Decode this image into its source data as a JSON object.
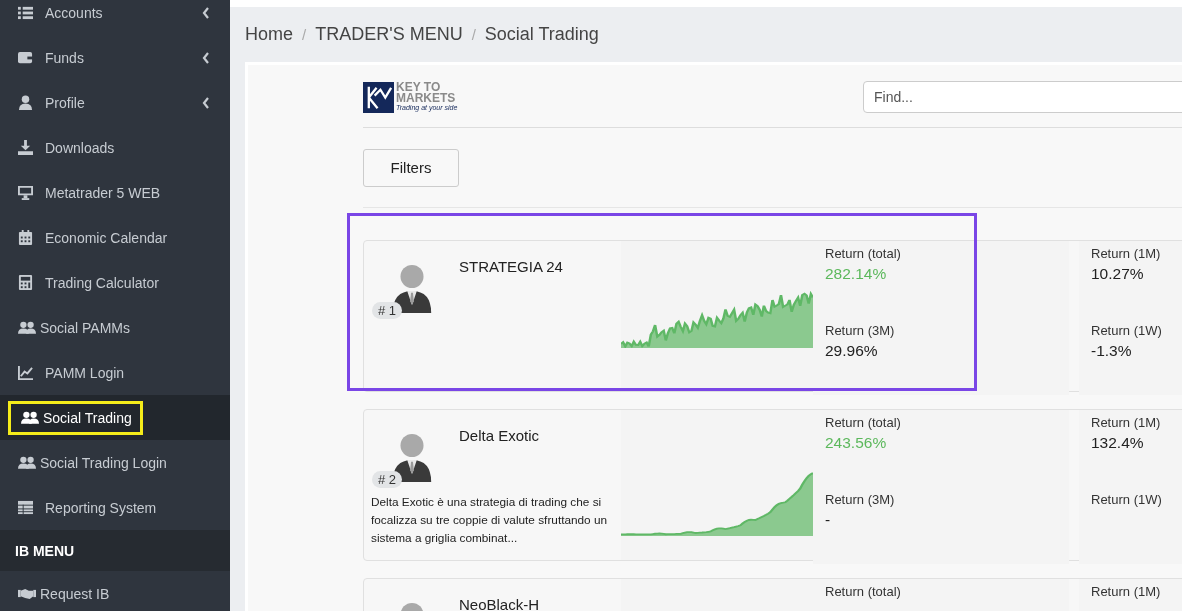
{
  "sidebar": {
    "items": [
      {
        "label": "Accounts",
        "expandable": true,
        "selected": false
      },
      {
        "label": "Funds",
        "expandable": true,
        "selected": false
      },
      {
        "label": "Profile",
        "expandable": true,
        "selected": false
      },
      {
        "label": "Downloads",
        "expandable": false,
        "selected": false
      },
      {
        "label": "Metatrader 5 WEB",
        "expandable": false,
        "selected": false
      },
      {
        "label": "Economic Calendar",
        "expandable": false,
        "selected": false
      },
      {
        "label": "Trading Calculator",
        "expandable": false,
        "selected": false
      },
      {
        "label": "Social PAMMs",
        "expandable": false,
        "selected": false
      },
      {
        "label": "PAMM Login",
        "expandable": false,
        "selected": false
      },
      {
        "label": "Social Trading",
        "expandable": false,
        "selected": true
      },
      {
        "label": "Social Trading Login",
        "expandable": false,
        "selected": false
      },
      {
        "label": "Reporting System",
        "expandable": false,
        "selected": false
      }
    ],
    "section": "IB MENU",
    "section_items": [
      {
        "label": "Request IB",
        "selected": false
      }
    ]
  },
  "breadcrumb": {
    "separator": "/",
    "items": [
      "Home",
      "TRADER'S MENU",
      "Social Trading"
    ]
  },
  "logo": {
    "line1": "KEY TO",
    "line2": "MARKETS",
    "tagline": "Trading at your side"
  },
  "search": {
    "placeholder": "Find..."
  },
  "filters_button": "Filters",
  "strategies": [
    {
      "name": "STRATEGIA 24",
      "rank": "# 1",
      "highlighted": true,
      "stats": [
        {
          "label": "Return (total)",
          "value": "282.14%",
          "highlight": true
        },
        {
          "label": "Return (1M)",
          "value": "10.27%",
          "highlight": false
        },
        {
          "label": "Return (3M)",
          "value": "29.96%",
          "highlight": false
        },
        {
          "label": "Return (1W)",
          "value": "-1.3%",
          "highlight": false
        }
      ]
    },
    {
      "name": "Delta Exotic",
      "rank": "# 2",
      "highlighted": false,
      "description": "Delta Exotic è una strategia di trading che si focalizza su tre coppie di valute sfruttando un sistema a griglia combinat...",
      "stats": [
        {
          "label": "Return (total)",
          "value": "243.56%",
          "highlight": true
        },
        {
          "label": "Return (1M)",
          "value": "132.4%",
          "highlight": false
        },
        {
          "label": "Return (3M)",
          "value": "-",
          "highlight": false
        },
        {
          "label": "Return (1W)"
        }
      ]
    },
    {
      "name": "NeoBlack-H",
      "highlighted": false,
      "stats": [
        {
          "label": "Return (total)"
        },
        {
          "label": "Return (1M)"
        }
      ]
    }
  ]
}
